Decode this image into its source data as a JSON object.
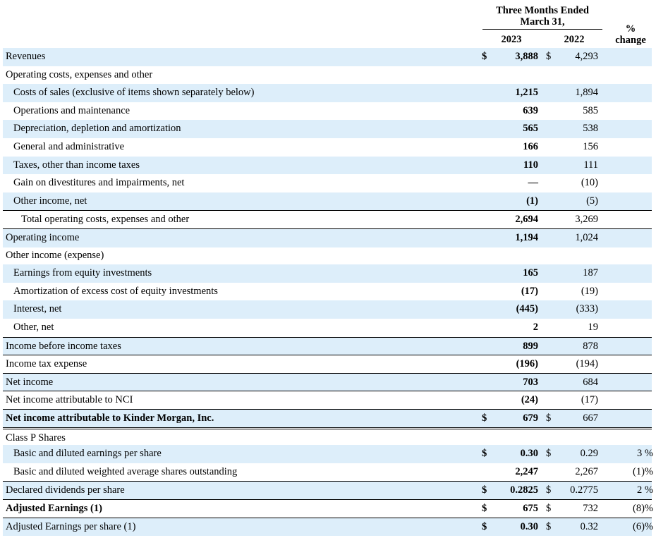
{
  "header": {
    "period_title_line1": "Three Months Ended",
    "period_title_line2": "March 31,",
    "col_2023": "2023",
    "col_2022": "2022",
    "pct_line1": "%",
    "pct_line2": "change"
  },
  "rows": [
    {
      "label": "Revenues",
      "dol1": "$",
      "v2023": "3,888",
      "dol2": "$",
      "v2022": "4,293",
      "pct": ""
    },
    {
      "label": "Operating costs, expenses and other",
      "dol1": "",
      "v2023": "",
      "dol2": "",
      "v2022": "",
      "pct": ""
    },
    {
      "label": "Costs of sales (exclusive of items shown separately below)",
      "dol1": "",
      "v2023": "1,215",
      "dol2": "",
      "v2022": "1,894",
      "pct": ""
    },
    {
      "label": "Operations and maintenance",
      "dol1": "",
      "v2023": "639",
      "dol2": "",
      "v2022": "585",
      "pct": ""
    },
    {
      "label": "Depreciation, depletion and amortization",
      "dol1": "",
      "v2023": "565",
      "dol2": "",
      "v2022": "538",
      "pct": ""
    },
    {
      "label": "General and administrative",
      "dol1": "",
      "v2023": "166",
      "dol2": "",
      "v2022": "156",
      "pct": ""
    },
    {
      "label": "Taxes, other than income taxes",
      "dol1": "",
      "v2023": "110",
      "dol2": "",
      "v2022": "111",
      "pct": ""
    },
    {
      "label": "Gain on divestitures and impairments, net",
      "dol1": "",
      "v2023": "—",
      "dol2": "",
      "v2022": "(10)",
      "pct": ""
    },
    {
      "label": "Other income, net",
      "dol1": "",
      "v2023": "(1)",
      "dol2": "",
      "v2022": "(5)",
      "pct": ""
    },
    {
      "label": "Total operating costs, expenses and other",
      "dol1": "",
      "v2023": "2,694",
      "dol2": "",
      "v2022": "3,269",
      "pct": ""
    },
    {
      "label": "Operating income",
      "dol1": "",
      "v2023": "1,194",
      "dol2": "",
      "v2022": "1,024",
      "pct": ""
    },
    {
      "label": "Other income (expense)",
      "dol1": "",
      "v2023": "",
      "dol2": "",
      "v2022": "",
      "pct": ""
    },
    {
      "label": "Earnings from equity investments",
      "dol1": "",
      "v2023": "165",
      "dol2": "",
      "v2022": "187",
      "pct": ""
    },
    {
      "label": "Amortization of excess cost of equity investments",
      "dol1": "",
      "v2023": "(17)",
      "dol2": "",
      "v2022": "(19)",
      "pct": ""
    },
    {
      "label": "Interest, net",
      "dol1": "",
      "v2023": "(445)",
      "dol2": "",
      "v2022": "(333)",
      "pct": ""
    },
    {
      "label": "Other, net",
      "dol1": "",
      "v2023": "2",
      "dol2": "",
      "v2022": "19",
      "pct": ""
    },
    {
      "label": "Income before income taxes",
      "dol1": "",
      "v2023": "899",
      "dol2": "",
      "v2022": "878",
      "pct": ""
    },
    {
      "label": "Income tax expense",
      "dol1": "",
      "v2023": "(196)",
      "dol2": "",
      "v2022": "(194)",
      "pct": ""
    },
    {
      "label": "Net income",
      "dol1": "",
      "v2023": "703",
      "dol2": "",
      "v2022": "684",
      "pct": ""
    },
    {
      "label": "Net income attributable to NCI",
      "dol1": "",
      "v2023": "(24)",
      "dol2": "",
      "v2022": "(17)",
      "pct": ""
    },
    {
      "label": "Net income attributable to Kinder Morgan, Inc.",
      "dol1": "$",
      "v2023": "679",
      "dol2": "$",
      "v2022": "667",
      "pct": ""
    },
    {
      "label": "Class P Shares",
      "dol1": "",
      "v2023": "",
      "dol2": "",
      "v2022": "",
      "pct": ""
    },
    {
      "label": "Basic and diluted earnings per share",
      "dol1": "$",
      "v2023": "0.30",
      "dol2": "$",
      "v2022": "0.29",
      "pct": "3 %"
    },
    {
      "label": "Basic and diluted weighted average shares outstanding",
      "dol1": "",
      "v2023": "2,247",
      "dol2": "",
      "v2022": "2,267",
      "pct": "(1)%"
    },
    {
      "label": "Declared dividends per share",
      "dol1": "$",
      "v2023": "0.2825",
      "dol2": "$",
      "v2022": "0.2775",
      "pct": "2 %"
    },
    {
      "label": "Adjusted Earnings (1)",
      "dol1": "$",
      "v2023": "675",
      "dol2": "$",
      "v2022": "732",
      "pct": "(8)%"
    },
    {
      "label": "Adjusted Earnings per share (1)",
      "dol1": "$",
      "v2023": "0.30",
      "dol2": "$",
      "v2022": "0.32",
      "pct": "(6)%"
    }
  ]
}
